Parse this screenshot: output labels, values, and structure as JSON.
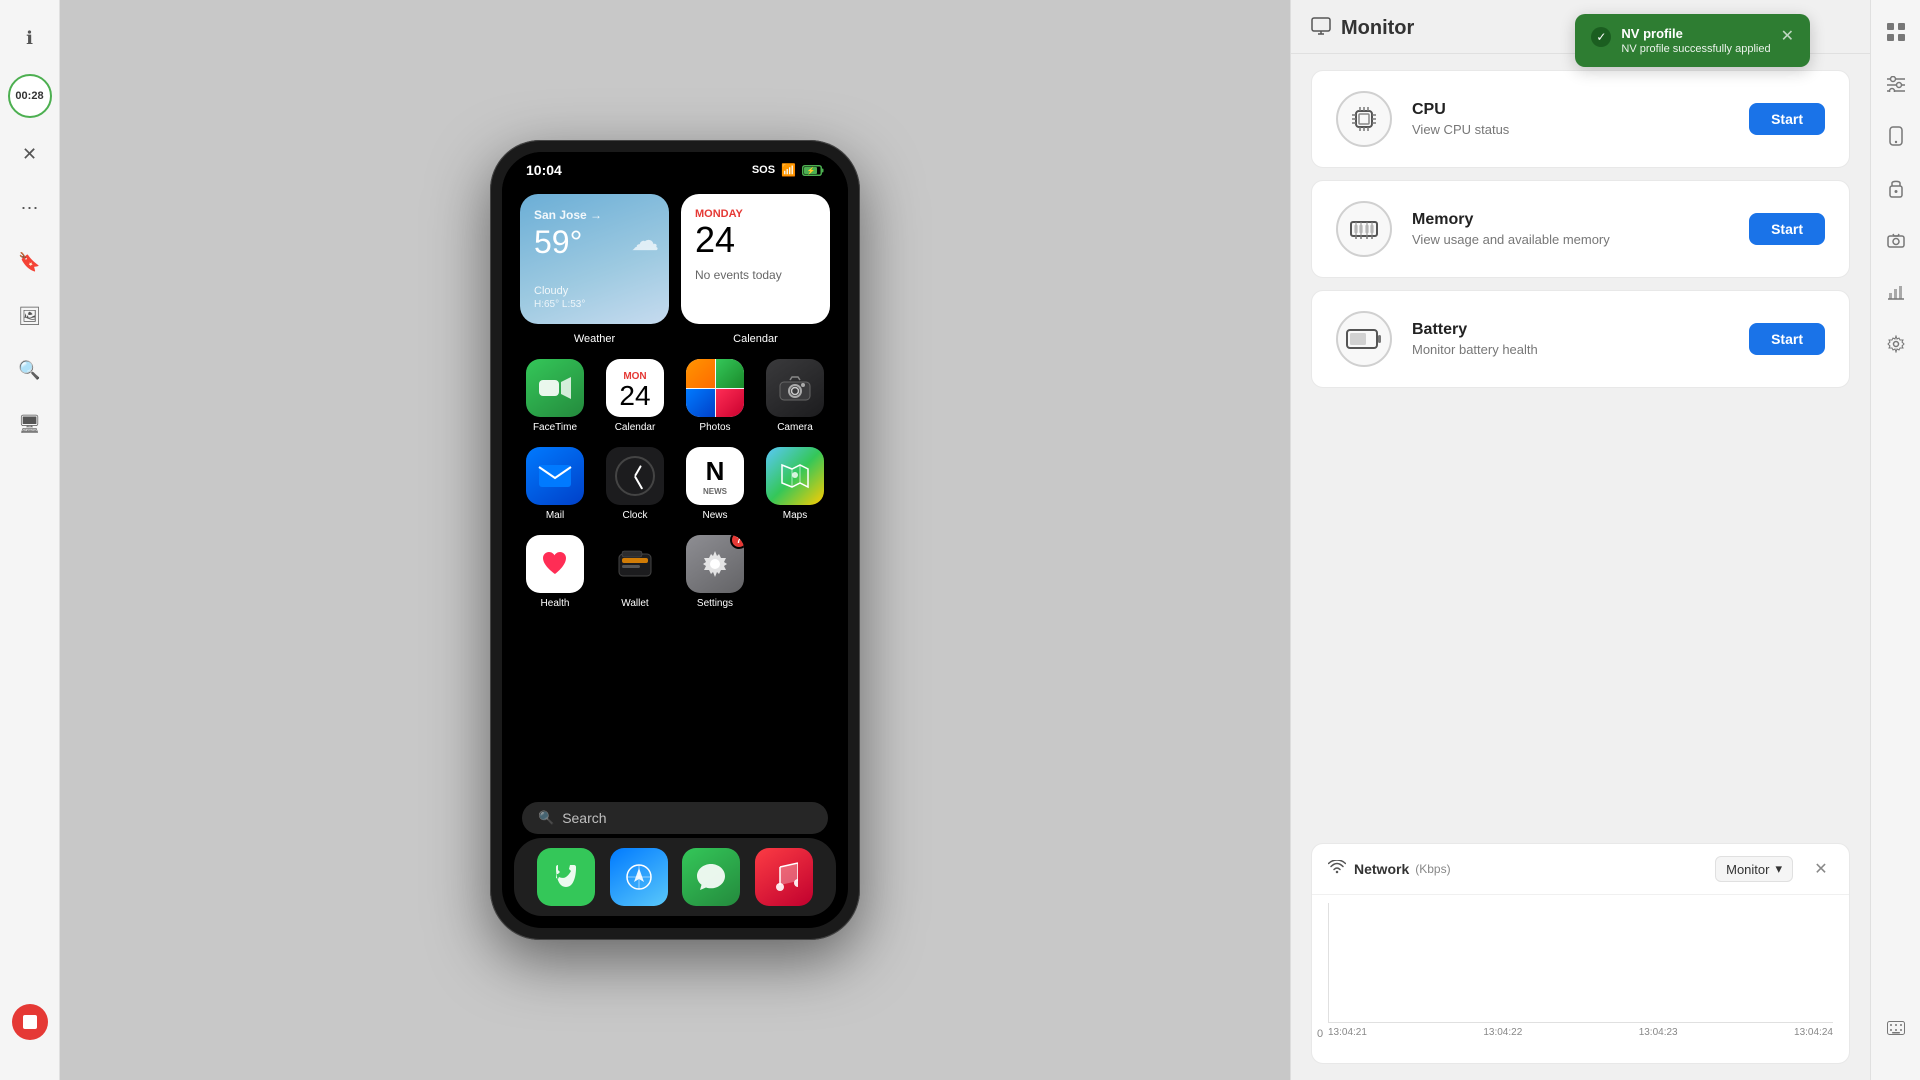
{
  "left_sidebar": {
    "icons": [
      "ℹ",
      "✕",
      "⋯",
      "🔖",
      "🔍",
      "🖥"
    ],
    "timer": "00:28",
    "stop_btn_label": "stop"
  },
  "phone": {
    "status_bar": {
      "time": "10:04",
      "sos": "SOS",
      "wifi": true,
      "battery": "charging"
    },
    "weather_widget": {
      "location": "San Jose →",
      "temp": "59°",
      "condition": "Cloudy",
      "high_low": "H:65° L:53°",
      "label": "Weather"
    },
    "calendar_widget": {
      "day": "MONDAY",
      "date": "24",
      "no_events": "No events today",
      "label": "Calendar"
    },
    "apps": [
      {
        "name": "FaceTime",
        "type": "facetime",
        "emoji": "📹"
      },
      {
        "name": "Calendar",
        "type": "calendar",
        "month": "MON",
        "date": "24"
      },
      {
        "name": "Photos",
        "type": "photos"
      },
      {
        "name": "Camera",
        "type": "camera",
        "emoji": "📷"
      },
      {
        "name": "Mail",
        "type": "mail",
        "emoji": "✉"
      },
      {
        "name": "Clock",
        "type": "clock"
      },
      {
        "name": "News",
        "type": "news"
      },
      {
        "name": "Maps",
        "type": "maps",
        "emoji": "🗺"
      },
      {
        "name": "Health",
        "type": "health",
        "emoji": "❤️"
      },
      {
        "name": "Wallet",
        "type": "wallet",
        "emoji": "💳"
      },
      {
        "name": "Settings",
        "type": "settings",
        "badge": "7",
        "emoji": "⚙"
      }
    ],
    "search": {
      "label": "Search",
      "icon": "🔍"
    },
    "dock": [
      {
        "name": "Phone",
        "emoji": "📞",
        "bg": "#34c759"
      },
      {
        "name": "Safari",
        "emoji": "🧭",
        "bg": "#007aff"
      },
      {
        "name": "Messages",
        "emoji": "💬",
        "bg": "#34c759"
      },
      {
        "name": "Music",
        "emoji": "🎵",
        "bg": "#fc3c44"
      }
    ]
  },
  "monitor": {
    "title": "Monitor",
    "icon": "monitor",
    "cards": [
      {
        "id": "cpu",
        "icon": "⬡",
        "icon_label": "cpu-chip",
        "title": "CPU",
        "description": "View CPU status",
        "button_label": "Start"
      },
      {
        "id": "memory",
        "icon": "▦",
        "icon_label": "memory-chip",
        "title": "Memory",
        "description": "View usage and available memory",
        "button_label": "Start"
      },
      {
        "id": "battery",
        "icon": "▭",
        "icon_label": "battery",
        "title": "Battery",
        "description": "Monitor battery health",
        "button_label": "Start"
      }
    ],
    "network": {
      "title": "Network",
      "unit": "(Kbps)",
      "dropdown_label": "Monitor",
      "chart_timestamps": [
        "13:04:21",
        "13:04:22",
        "13:04:23",
        "13:04:24"
      ],
      "chart_zero": "0"
    }
  },
  "toast": {
    "title": "NV profile",
    "description": "NV profile successfully applied",
    "icon": "✓"
  },
  "right_sidebar_icons": [
    "⊞",
    "≡",
    "◫",
    "🔒",
    "📷",
    "📊",
    "⚙"
  ]
}
